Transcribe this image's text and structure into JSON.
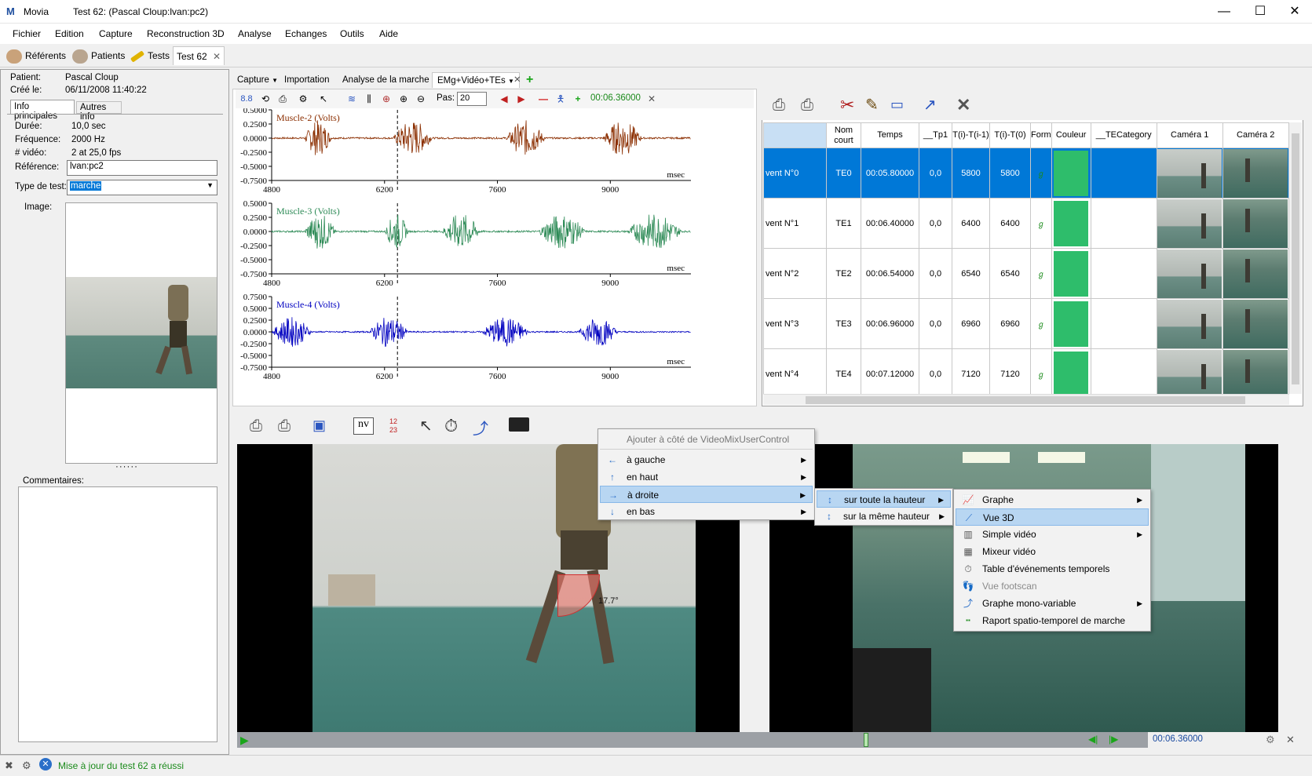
{
  "window": {
    "app": "Movia",
    "title": "Test 62: (Pascal Cloup:lvan:pc2)",
    "min": "—",
    "max": "☐",
    "close": "✕"
  },
  "menu": [
    "Fichier",
    "Edition",
    "Capture",
    "Reconstruction 3D",
    "Analyse",
    "Echanges",
    "Outils",
    "Aide"
  ],
  "doctabs": {
    "referents": "Référents",
    "patients": "Patients",
    "tests": "Tests",
    "test": "Test 62",
    "close": "✕"
  },
  "left": {
    "patient_label": "Patient:",
    "patient": "Pascal Cloup",
    "created_label": "Créé le:",
    "created": "06/11/2008 11:40:22",
    "tab1": "Info principales",
    "tab2": "Autres info",
    "duree_label": "Durée:",
    "duree": "10,0 sec",
    "freq_label": "Fréquence:",
    "freq": "2000 Hz",
    "video_label": "# vidéo:",
    "video": "2 at 25,0 fps",
    "ref_label": "Référence:",
    "ref": "lvan:pc2",
    "type_label": "Type de test:",
    "type": "marche",
    "image_label": "Image:",
    "comments_label": "Commentaires:"
  },
  "mtabs": {
    "capture": "Capture",
    "importation": "Importation",
    "analyse": "Analyse de la marche",
    "emg": "EMg+Vidéo+TEs",
    "close": "✕",
    "add": "+"
  },
  "chart_toolbar": {
    "scale": "8.8",
    "pas_label": "Pas:",
    "pas": "20",
    "time": "00:06.36000",
    "close": "✕"
  },
  "chart_data": [
    {
      "type": "line",
      "title": "Muscle-2 (Volts)",
      "xlabel": "msec",
      "color": "#8b2e00",
      "xlim": [
        4800,
        10000
      ],
      "ylim": [
        -0.75,
        0.5
      ],
      "xticks": [
        "4800",
        "6200",
        "7600",
        "9000"
      ],
      "yticks": [
        "0.5000",
        "0.2500",
        "0.0000",
        "-0.2500",
        "-0.5000",
        "-0.7500"
      ],
      "cursor_x": 6360,
      "bursts": [
        [
          5200,
          5550
        ],
        [
          6300,
          6800
        ],
        [
          7700,
          8200
        ],
        [
          8900,
          9400
        ]
      ]
    },
    {
      "type": "line",
      "title": "Muscle-3 (Volts)",
      "xlabel": "msec",
      "color": "#2e8b57",
      "xlim": [
        4800,
        10000
      ],
      "ylim": [
        -0.75,
        0.5
      ],
      "xticks": [
        "4800",
        "6200",
        "7600",
        "9000"
      ],
      "yticks": [
        "0.5000",
        "0.2500",
        "0.0000",
        "-0.2500",
        "-0.5000",
        "-0.7500"
      ],
      "cursor_x": 6360,
      "bursts": [
        [
          5200,
          5600
        ],
        [
          6200,
          6500
        ],
        [
          6900,
          7400
        ],
        [
          8100,
          8700
        ],
        [
          9200,
          9900
        ]
      ]
    },
    {
      "type": "line",
      "title": "Muscle-4 (Volts)",
      "xlabel": "msec",
      "color": "#0000c0",
      "xlim": [
        4800,
        10000
      ],
      "ylim": [
        -0.75,
        0.75
      ],
      "xticks": [
        "4800",
        "6200",
        "7600",
        "9000"
      ],
      "yticks": [
        "0.7500",
        "0.5000",
        "0.2500",
        "0.0000",
        "-0.2500",
        "-0.5000",
        "-0.7500"
      ],
      "cursor_x": 6360,
      "bursts": [
        [
          4800,
          5300
        ],
        [
          6000,
          6500
        ],
        [
          7400,
          8000
        ],
        [
          8600,
          9100
        ]
      ]
    }
  ],
  "grid": {
    "headers": [
      "",
      "Nom court",
      "Temps",
      "__Tp1",
      "T(i)-T(i-1)",
      "T(i)-T(0)",
      "Form",
      "Couleur",
      "__TECategory",
      "Caméra 1",
      "Caméra 2"
    ],
    "rows": [
      [
        "vent N°0",
        "TE0",
        "00:05.80000",
        "0,0",
        "5800",
        "5800"
      ],
      [
        "vent N°1",
        "TE1",
        "00:06.40000",
        "0,0",
        "6400",
        "6400"
      ],
      [
        "vent N°2",
        "TE2",
        "00:06.54000",
        "0,0",
        "6540",
        "6540"
      ],
      [
        "vent N°3",
        "TE3",
        "00:06.96000",
        "0,0",
        "6960",
        "6960"
      ],
      [
        "vent N°4",
        "TE4",
        "00:07.12000",
        "0,0",
        "7120",
        "7120"
      ]
    ],
    "color_hex": "#2ebd6b",
    "selected_hex": "#0078d7"
  },
  "video": {
    "time": "00:06.36000",
    "angle": "17.7°"
  },
  "ctx": {
    "header": "Ajouter à côté de VideoMixUserControl",
    "l1": [
      "à gauche",
      "en haut",
      "à droite",
      "en bas"
    ],
    "l2": [
      "sur toute la hauteur",
      "sur la même hauteur"
    ],
    "l3": [
      "Graphe",
      "Vue 3D",
      "Simple vidéo",
      "Mixeur vidéo",
      "Table d'événements temporels",
      "Vue footscan",
      "Graphe mono-variable",
      "Raport spatio-temporel de marche"
    ]
  },
  "status": {
    "text": "Mise à jour du test 62 a réussi",
    "color": "#1a8a1a"
  }
}
